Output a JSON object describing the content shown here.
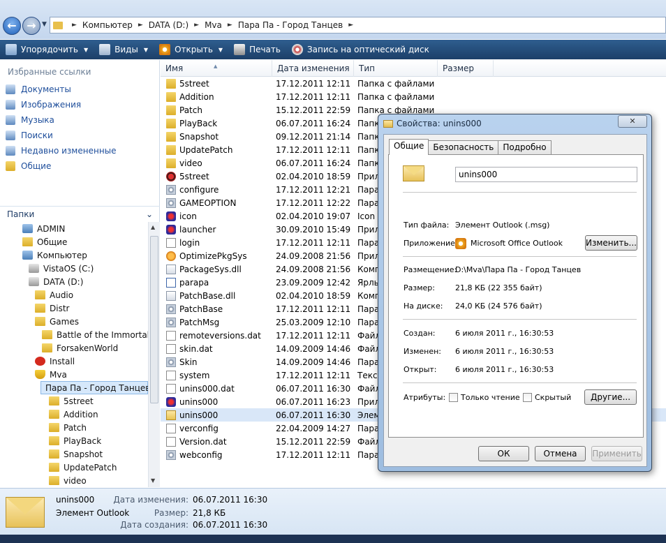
{
  "address": {
    "crumbs": [
      "Компьютер",
      "DATA (D:)",
      "Mva",
      "Пара Па - Город Танцев"
    ]
  },
  "toolbar": {
    "organize": "Упорядочить",
    "views": "Виды",
    "open": "Открыть",
    "print": "Печать",
    "burn": "Запись на оптический диск"
  },
  "favorites": {
    "title": "Избранные ссылки",
    "items": [
      "Документы",
      "Изображения",
      "Музыка",
      "Поиски",
      "Недавно измененные",
      "Общие"
    ]
  },
  "folders": {
    "title": "Папки",
    "tree": [
      "ADMIN",
      "Общие",
      "Компьютер",
      "VistaOS (C:)",
      "DATA (D:)",
      "Audio",
      "Distr",
      "Games",
      "Battle of the Immortals",
      "ForsakenWorld",
      "Install",
      "Mva",
      "Пара Па - Город Танцев",
      "5street",
      "Addition",
      "Patch",
      "PlayBack",
      "Snapshot",
      "UpdatePatch",
      "video"
    ]
  },
  "columns": [
    "Имя",
    "Дата изменения",
    "Тип",
    "Размер"
  ],
  "files": [
    {
      "name": "5street",
      "date": "17.12.2011 12:11",
      "type": "Папка с файлами",
      "icon": "folder"
    },
    {
      "name": "Addition",
      "date": "17.12.2011 12:11",
      "type": "Папка с файлами",
      "icon": "folder"
    },
    {
      "name": "Patch",
      "date": "15.12.2011 22:59",
      "type": "Папка с файлами",
      "icon": "folder"
    },
    {
      "name": "PlayBack",
      "date": "06.07.2011 16:24",
      "type": "Папк",
      "icon": "folder"
    },
    {
      "name": "Snapshot",
      "date": "09.12.2011 21:14",
      "type": "Папк",
      "icon": "folder"
    },
    {
      "name": "UpdatePatch",
      "date": "17.12.2011 12:11",
      "type": "Папк",
      "icon": "folder"
    },
    {
      "name": "video",
      "date": "06.07.2011 16:24",
      "type": "Папк",
      "icon": "folder"
    },
    {
      "name": "5street",
      "date": "02.04.2010 18:59",
      "type": "Прил",
      "icon": "exe"
    },
    {
      "name": "configure",
      "date": "17.12.2011 12:21",
      "type": "Пара",
      "icon": "gear"
    },
    {
      "name": "GAMEOPTION",
      "date": "17.12.2011 12:22",
      "type": "Пара",
      "icon": "gear"
    },
    {
      "name": "icon",
      "date": "02.04.2010 19:07",
      "type": "Icon",
      "icon": "blue"
    },
    {
      "name": "launcher",
      "date": "30.09.2010 15:49",
      "type": "Прил",
      "icon": "blue"
    },
    {
      "name": "login",
      "date": "17.12.2011 12:11",
      "type": "Пара",
      "icon": "file"
    },
    {
      "name": "OptimizePkgSys",
      "date": "24.09.2008 21:56",
      "type": "Прил",
      "icon": "orange"
    },
    {
      "name": "PackageSys.dll",
      "date": "24.09.2008 21:56",
      "type": "Комп",
      "icon": "dll"
    },
    {
      "name": "parapa",
      "date": "23.09.2009 12:42",
      "type": "Ярль",
      "icon": "link"
    },
    {
      "name": "PatchBase.dll",
      "date": "02.04.2010 18:59",
      "type": "Комп",
      "icon": "dll"
    },
    {
      "name": "PatchBase",
      "date": "17.12.2011 12:11",
      "type": "Пара",
      "icon": "gear"
    },
    {
      "name": "PatchMsg",
      "date": "25.03.2009 12:10",
      "type": "Пара",
      "icon": "gear"
    },
    {
      "name": "remoteversions.dat",
      "date": "17.12.2011 12:11",
      "type": "Файл",
      "icon": "file"
    },
    {
      "name": "skin.dat",
      "date": "14.09.2009 14:46",
      "type": "Файл",
      "icon": "file"
    },
    {
      "name": "Skin",
      "date": "14.09.2009 14:46",
      "type": "Пара",
      "icon": "gear"
    },
    {
      "name": "system",
      "date": "17.12.2011 12:11",
      "type": "Текс",
      "icon": "file"
    },
    {
      "name": "unins000.dat",
      "date": "06.07.2011 16:30",
      "type": "Файл",
      "icon": "file"
    },
    {
      "name": "unins000",
      "date": "06.07.2011 16:23",
      "type": "Прил",
      "icon": "blue"
    },
    {
      "name": "unins000",
      "date": "06.07.2011 16:30",
      "type": "Элем",
      "icon": "msg",
      "selected": true
    },
    {
      "name": "verconfig",
      "date": "22.04.2009 14:27",
      "type": "Пара",
      "icon": "file"
    },
    {
      "name": "Version.dat",
      "date": "15.12.2011 22:59",
      "type": "Файл",
      "icon": "file"
    },
    {
      "name": "webconfig",
      "date": "17.12.2011 12:11",
      "type": "Пара",
      "icon": "gear"
    }
  ],
  "details": {
    "name": "unins000",
    "type": "Элемент Outlook",
    "labels": [
      "Дата изменения:",
      "Размер:",
      "Дата создания:"
    ],
    "values": [
      "06.07.2011 16:30",
      "21,8 КБ",
      "06.07.2011 16:30"
    ]
  },
  "dialog": {
    "title": "Свойства: unins000",
    "tabs": [
      "Общие",
      "Безопасность",
      "Подробно"
    ],
    "filename": "unins000",
    "type_label": "Тип файла:",
    "type_value": "Элемент Outlook (.msg)",
    "app_label": "Приложение:",
    "app_value": "Microsoft Office Outlook",
    "change_btn": "Изменить...",
    "location_label": "Размещение:",
    "location_value": "D:\\Mva\\Пара Па - Город Танцев",
    "size_label": "Размер:",
    "size_value": "21,8 КБ (22 355 байт)",
    "disk_label": "На диске:",
    "disk_value": "24,0 КБ (24 576 байт)",
    "created_label": "Создан:",
    "created_value": "6 июля 2011 г., 16:30:53",
    "modified_label": "Изменен:",
    "modified_value": "6 июля 2011 г., 16:30:53",
    "opened_label": "Открыт:",
    "opened_value": "6 июля 2011 г., 16:30:53",
    "attr_label": "Атрибуты:",
    "readonly": "Только чтение",
    "hidden": "Скрытый",
    "other_btn": "Другие...",
    "ok": "ОК",
    "cancel": "Отмена",
    "apply": "Применить"
  }
}
